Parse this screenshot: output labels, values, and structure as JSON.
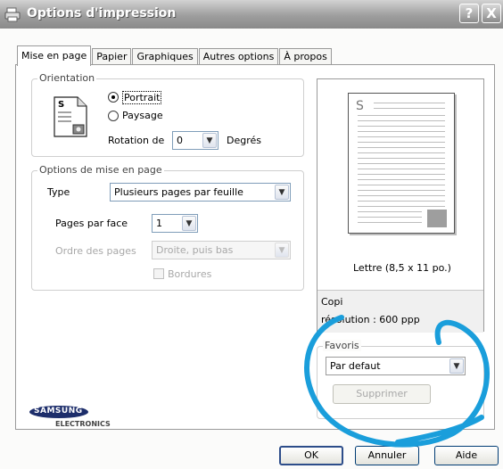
{
  "window": {
    "title": "Options d'impression",
    "help_button": "?",
    "close_button": "X"
  },
  "tabs": [
    "Mise en page",
    "Papier",
    "Graphiques",
    "Autres options",
    "À propos"
  ],
  "orientation": {
    "legend": "Orientation",
    "portrait": "Portrait",
    "paysage": "Paysage",
    "selected": "Portrait",
    "rotation_label": "Rotation de",
    "rotation_value": "0",
    "rotation_unit": "Degrés"
  },
  "layout_options": {
    "legend": "Options de mise en page",
    "type_label": "Type",
    "type_value": "Plusieurs pages par feuille",
    "pages_per_side_label": "Pages par face",
    "pages_per_side_value": "1",
    "order_label": "Ordre des pages",
    "order_value": "Droite, puis bas",
    "borders_label": "Bordures"
  },
  "preview": {
    "paper_letter": "S",
    "paper_size": "Lettre (8,5 x 11 po.)",
    "copies": "Copi",
    "resolution": "résolution : 600 ppp"
  },
  "favorites": {
    "legend": "Favoris",
    "value": "Par defaut",
    "delete_button": "Supprimer"
  },
  "brand": {
    "name": "SAMSUNG",
    "sub": "ELECTRONICS"
  },
  "buttons": {
    "ok": "OK",
    "cancel": "Annuler",
    "help": "Aide"
  },
  "colors": {
    "annotation": "#1a9edb",
    "titlebar": "#9e9e9e"
  }
}
